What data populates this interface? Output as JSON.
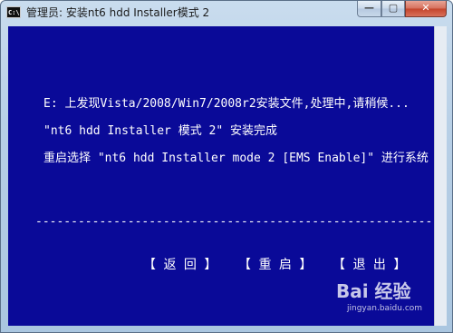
{
  "window": {
    "title": "管理员:  安装nt6 hdd Installer模式 2",
    "icon_text": "C:\\",
    "controls": {
      "minimize": "—",
      "maximize": "▢",
      "close": "✕"
    }
  },
  "console": {
    "lines": [
      "E: 上发现Vista/2008/Win7/2008r2安装文件,处理中,请稍候...",
      "\"nt6 hdd Installer 模式 2\" 安装完成",
      "重启选择 \"nt6 hdd Installer mode 2 [EMS Enable]\" 进行系统"
    ],
    "separator": "----------------------------------------------------------------------------",
    "menu": {
      "back": "【 返 回 】",
      "reboot": "【 重 启 】",
      "exit": "【 退 出 】"
    }
  },
  "watermark": {
    "logo": "Bai 经验",
    "url": "jingyan.baidu.com"
  },
  "colors": {
    "console_bg": "#0a0a98",
    "console_text": "#ffffff",
    "titlebar": "#b7cfe6",
    "close_button": "#c4432b"
  }
}
